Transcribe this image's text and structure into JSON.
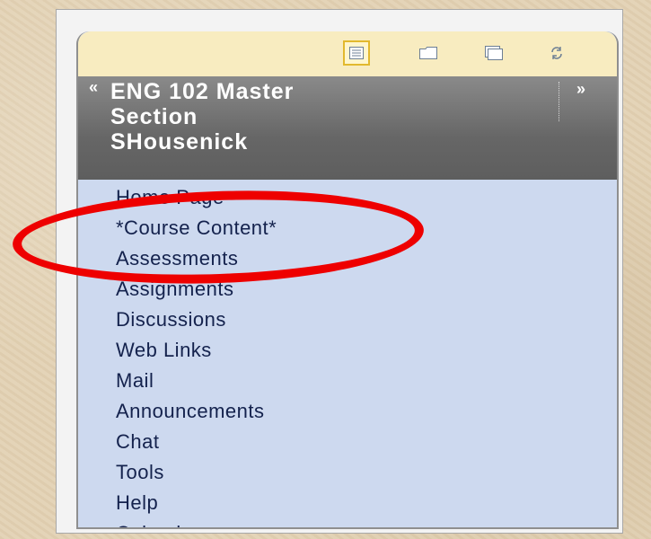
{
  "toolbar": {
    "icons": [
      "list-view-icon",
      "folder-icon",
      "window-icon",
      "refresh-icon"
    ]
  },
  "course": {
    "collapse_glyph": "«",
    "title": "ENG 102 Master\nSection\nSHousenick",
    "expand_glyph": "»"
  },
  "nav": {
    "items": [
      {
        "label": "Home Page"
      },
      {
        "label": "*Course Content*"
      },
      {
        "label": "Assessments"
      },
      {
        "label": "Assignments"
      },
      {
        "label": "Discussions"
      },
      {
        "label": "Web Links"
      },
      {
        "label": "Mail"
      },
      {
        "label": "Announcements"
      },
      {
        "label": "Chat"
      },
      {
        "label": "Tools"
      },
      {
        "label": "Help"
      },
      {
        "label": "Calendar"
      }
    ]
  },
  "colors": {
    "background": "#e3d2b4",
    "toolbar": "#f8ecc0",
    "header": "#6a6a6a",
    "nav_bg": "#cdd9ef",
    "nav_text": "#14224d",
    "highlight_ring": "#ee0000"
  }
}
